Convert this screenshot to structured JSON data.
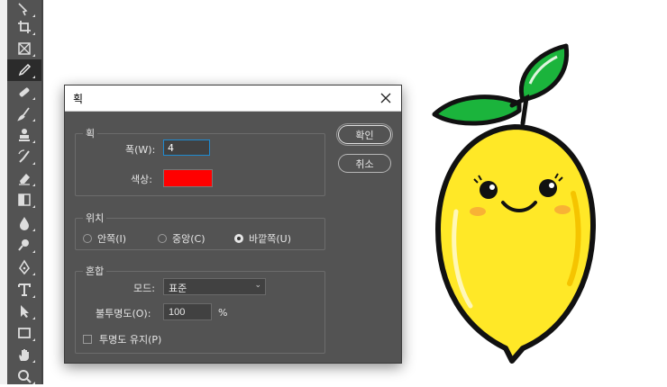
{
  "toolbar": {
    "tools": [
      {
        "name": "move-tool",
        "icon": "move-icon"
      },
      {
        "name": "crop-tool",
        "icon": "crop-icon"
      },
      {
        "name": "frame-tool",
        "icon": "frame-icon"
      },
      {
        "name": "eyedropper-tool",
        "icon": "eyedropper-icon",
        "selected": true
      },
      {
        "name": "healing-brush-tool",
        "icon": "bandage-icon"
      },
      {
        "name": "brush-tool",
        "icon": "brush-icon"
      },
      {
        "name": "clone-stamp-tool",
        "icon": "stamp-icon"
      },
      {
        "name": "history-brush-tool",
        "icon": "history-brush-icon"
      },
      {
        "name": "eraser-tool",
        "icon": "eraser-icon"
      },
      {
        "name": "gradient-tool",
        "icon": "gradient-icon"
      },
      {
        "name": "blur-tool",
        "icon": "drop-icon"
      },
      {
        "name": "dodge-tool",
        "icon": "dodge-icon"
      },
      {
        "name": "pen-tool",
        "icon": "pen-icon"
      },
      {
        "name": "type-tool",
        "icon": "type-icon"
      },
      {
        "name": "path-selection-tool",
        "icon": "arrow-icon"
      },
      {
        "name": "rectangle-tool",
        "icon": "rectangle-icon"
      },
      {
        "name": "hand-tool",
        "icon": "hand-icon"
      },
      {
        "name": "zoom-tool",
        "icon": "zoom-icon"
      }
    ]
  },
  "dialog": {
    "title": "획",
    "stroke": {
      "legend": "획",
      "width_label": "폭(W):",
      "width_value": "4",
      "color_label": "색상:",
      "color": "#ff0000"
    },
    "location": {
      "legend": "위치",
      "options": [
        "안쪽(I)",
        "중앙(C)",
        "바깥쪽(U)"
      ],
      "selected": "바깥쪽(U)"
    },
    "blending": {
      "legend": "혼합",
      "mode_label": "모드:",
      "mode_value": "표준",
      "opacity_label": "불투명도(O):",
      "opacity_value": "100",
      "opacity_unit": "%",
      "preserve_label": "투명도 유지(P)",
      "preserve_checked": false
    },
    "ok_label": "확인",
    "cancel_label": "취소"
  },
  "colors": {
    "dialog_bg": "#535353",
    "toolbar_bg": "#535353",
    "lemon_yellow": "#ffe827",
    "leaf_green": "#1bb43c"
  }
}
